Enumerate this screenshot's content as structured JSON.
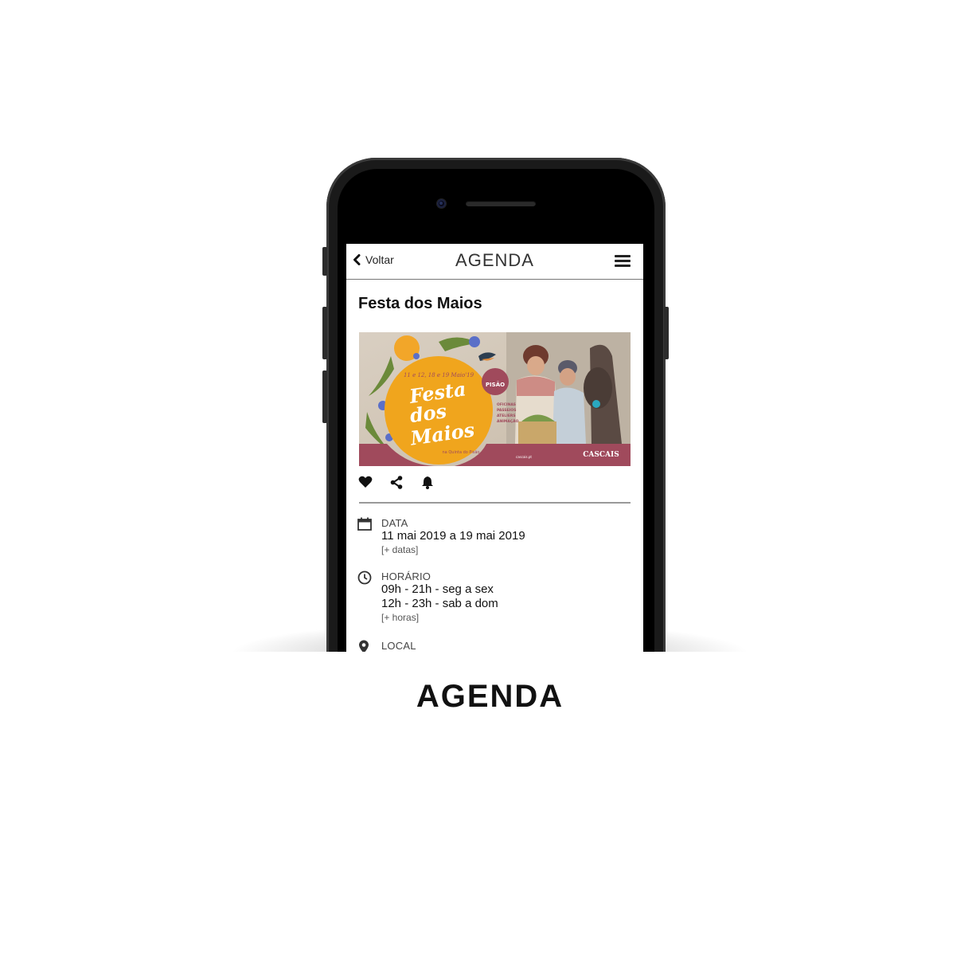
{
  "app": {
    "back_label": "Voltar",
    "header_title": "AGENDA",
    "menu_icon": "hamburger-menu-icon"
  },
  "event": {
    "title": "Festa dos Maios",
    "banner": {
      "dates": "11 e 12, 18 e 19 Maio'19",
      "line1": "Festa",
      "line2": "dos",
      "line3": "Maios",
      "venue": "na Quinta do Pisão",
      "logo": "PISÃO",
      "activities": [
        "OFICINAS",
        "PASSEIOS",
        "ATELIERS",
        "ANIMAÇÃO"
      ],
      "footer_url": "cascais.pt",
      "brand": "CASCAIS"
    },
    "actions": [
      {
        "icon": "heart-icon"
      },
      {
        "icon": "share-icon"
      },
      {
        "icon": "bell-icon"
      }
    ],
    "data": {
      "label": "DATA",
      "value": "11 mai 2019 a 19 mai 2019",
      "more": "[+ datas]"
    },
    "horario": {
      "label": "HORÁRIO",
      "line1": "09h - 21h - seg a sex",
      "line2": "12h - 23h - sab a dom",
      "more": "[+ horas]"
    },
    "local": {
      "label": "LOCAL"
    }
  },
  "caption": "AGENDA",
  "colors": {
    "accent_maroon": "#a04a5c",
    "accent_orange": "#f0a51d"
  }
}
